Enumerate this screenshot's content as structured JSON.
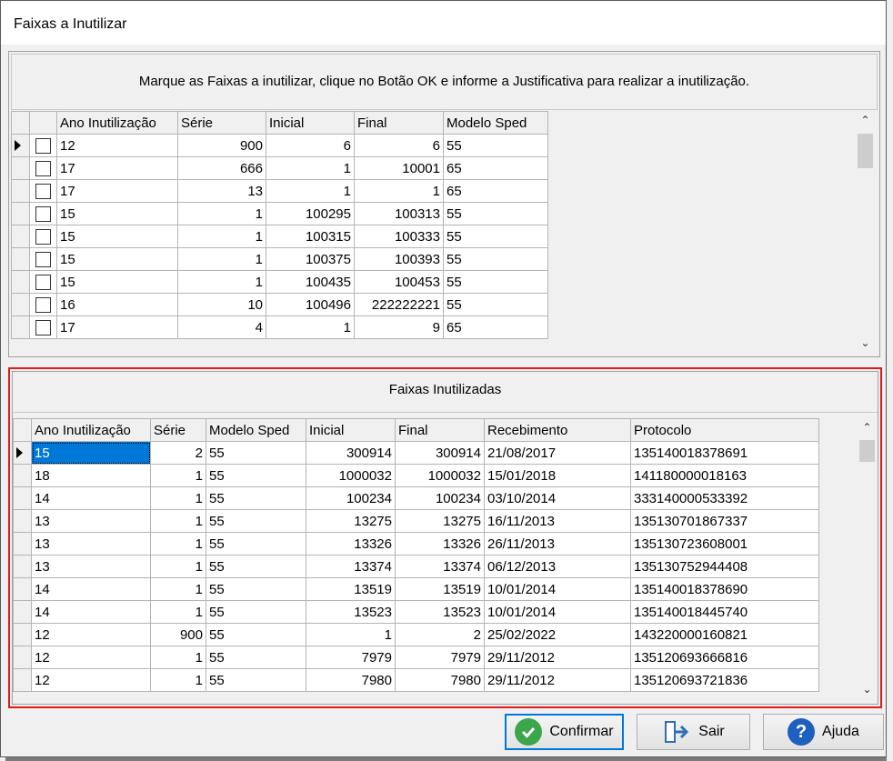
{
  "window": {
    "title": "Faixas a Inutilizar"
  },
  "instruction": "Marque as Faixas a inutilizar, clique no Botão OK e informe a Justificativa para realizar a inutilização.",
  "top_grid": {
    "columns": [
      "Ano Inutilização",
      "Série",
      "Inicial",
      "Final",
      "Modelo Sped"
    ],
    "rows": [
      [
        "12",
        "900",
        "6",
        "6",
        "55"
      ],
      [
        "17",
        "666",
        "1",
        "10001",
        "65"
      ],
      [
        "17",
        "13",
        "1",
        "1",
        "65"
      ],
      [
        "15",
        "1",
        "100295",
        "100313",
        "55"
      ],
      [
        "15",
        "1",
        "100315",
        "100333",
        "55"
      ],
      [
        "15",
        "1",
        "100375",
        "100393",
        "55"
      ],
      [
        "15",
        "1",
        "100435",
        "100453",
        "55"
      ],
      [
        "16",
        "10",
        "100496",
        "222222221",
        "55"
      ],
      [
        "17",
        "4",
        "1",
        "9",
        "65"
      ]
    ]
  },
  "bottom_section": {
    "title": "Faixas Inutilizadas",
    "columns": [
      "Ano Inutilização",
      "Série",
      "Modelo Sped",
      "Inicial",
      "Final",
      "Recebimento",
      "Protocolo"
    ],
    "rows": [
      [
        "15",
        "2",
        "55",
        "300914",
        "300914",
        "21/08/2017",
        "135140018378691"
      ],
      [
        "18",
        "1",
        "55",
        "1000032",
        "1000032",
        "15/01/2018",
        "141180000018163"
      ],
      [
        "14",
        "1",
        "55",
        "100234",
        "100234",
        "03/10/2014",
        "333140000533392"
      ],
      [
        "13",
        "1",
        "55",
        "13275",
        "13275",
        "16/11/2013",
        "135130701867337"
      ],
      [
        "13",
        "1",
        "55",
        "13326",
        "13326",
        "26/11/2013",
        "135130723608001"
      ],
      [
        "13",
        "1",
        "55",
        "13374",
        "13374",
        "06/12/2013",
        "135130752944408"
      ],
      [
        "14",
        "1",
        "55",
        "13519",
        "13519",
        "10/01/2014",
        "135140018378690"
      ],
      [
        "14",
        "1",
        "55",
        "13523",
        "13523",
        "10/01/2014",
        "135140018445740"
      ],
      [
        "12",
        "900",
        "55",
        "1",
        "2",
        "25/02/2022",
        "143220000160821"
      ],
      [
        "12",
        "1",
        "55",
        "7979",
        "7979",
        "29/11/2012",
        "135120693666816"
      ],
      [
        "12",
        "1",
        "55",
        "7980",
        "7980",
        "29/11/2012",
        "135120693721836"
      ]
    ]
  },
  "buttons": {
    "confirm": "Confirmar",
    "exit": "Sair",
    "help": "Ajuda"
  },
  "icons": {
    "confirm": "check-circle-icon",
    "exit": "exit-door-icon",
    "help": "question-circle-icon"
  },
  "colors": {
    "selection": "#0078d7",
    "highlight_border": "#e01b1b",
    "confirm_icon": "#3ca64a",
    "help_icon": "#1f5fbf"
  }
}
